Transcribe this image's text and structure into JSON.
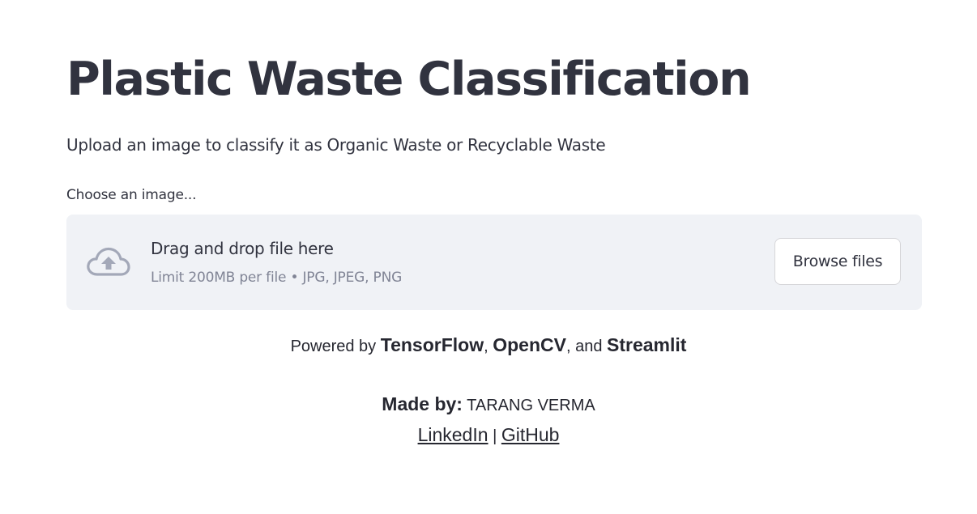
{
  "page": {
    "title": "Plastic Waste Classification",
    "subtitle": "Upload an image to classify it as Organic Waste or Recyclable Waste"
  },
  "uploader": {
    "label": "Choose an image...",
    "instructions": "Drag and drop file here",
    "limit_text": "Limit 200MB per file • JPG, JPEG, PNG",
    "browse_label": "Browse files",
    "icon": "cloud-upload-icon"
  },
  "footer": {
    "powered_prefix": "Powered by ",
    "tech_1": "TensorFlow",
    "sep_1": ", ",
    "tech_2": "OpenCV",
    "sep_2": ", and ",
    "tech_3": "Streamlit",
    "made_by_label": "Made by:",
    "author": " TARANG VERMA",
    "link_linkedin": "LinkedIn",
    "link_separator": " | ",
    "link_github": "GitHub"
  },
  "colors": {
    "text": "#31333f",
    "dropzone_bg": "#f0f2f6",
    "muted_text": "#808495",
    "icon": "#a3a8b8"
  }
}
